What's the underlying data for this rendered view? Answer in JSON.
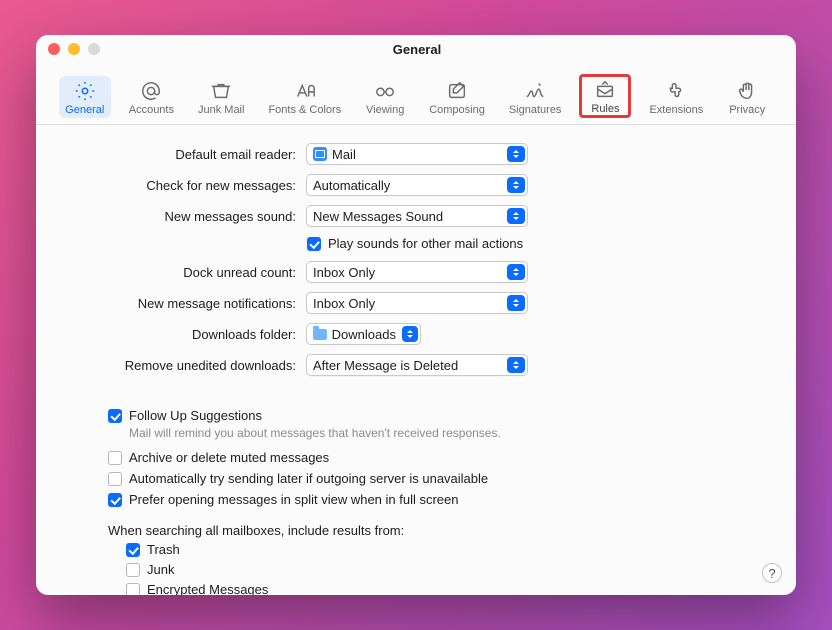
{
  "window": {
    "title": "General"
  },
  "toolbar": {
    "items": [
      {
        "id": "general",
        "label": "General"
      },
      {
        "id": "accounts",
        "label": "Accounts"
      },
      {
        "id": "junk",
        "label": "Junk Mail"
      },
      {
        "id": "fonts",
        "label": "Fonts & Colors"
      },
      {
        "id": "viewing",
        "label": "Viewing"
      },
      {
        "id": "composing",
        "label": "Composing"
      },
      {
        "id": "signatures",
        "label": "Signatures"
      },
      {
        "id": "rules",
        "label": "Rules"
      },
      {
        "id": "extensions",
        "label": "Extensions"
      },
      {
        "id": "privacy",
        "label": "Privacy"
      }
    ]
  },
  "form": {
    "default_reader_label": "Default email reader:",
    "default_reader_value": "Mail",
    "check_new_label": "Check for new messages:",
    "check_new_value": "Automatically",
    "new_sound_label": "New messages sound:",
    "new_sound_value": "New Messages Sound",
    "play_sounds_label": "Play sounds for other mail actions",
    "play_sounds_checked": true,
    "dock_unread_label": "Dock unread count:",
    "dock_unread_value": "Inbox Only",
    "new_notif_label": "New message notifications:",
    "new_notif_value": "Inbox Only",
    "downloads_label": "Downloads folder:",
    "downloads_value": "Downloads",
    "remove_label": "Remove unedited downloads:",
    "remove_value": "After Message is Deleted"
  },
  "options": {
    "followup_label": "Follow Up Suggestions",
    "followup_hint": "Mail will remind you about messages that haven't received responses.",
    "followup_checked": true,
    "archive_label": "Archive or delete muted messages",
    "archive_checked": false,
    "retry_label": "Automatically try sending later if outgoing server is unavailable",
    "retry_checked": false,
    "split_label": "Prefer opening messages in split view when in full screen",
    "split_checked": true
  },
  "search": {
    "heading": "When searching all mailboxes, include results from:",
    "trash_label": "Trash",
    "trash_checked": true,
    "junk_label": "Junk",
    "junk_checked": false,
    "encrypted_label": "Encrypted Messages",
    "encrypted_checked": false
  },
  "help_label": "?"
}
